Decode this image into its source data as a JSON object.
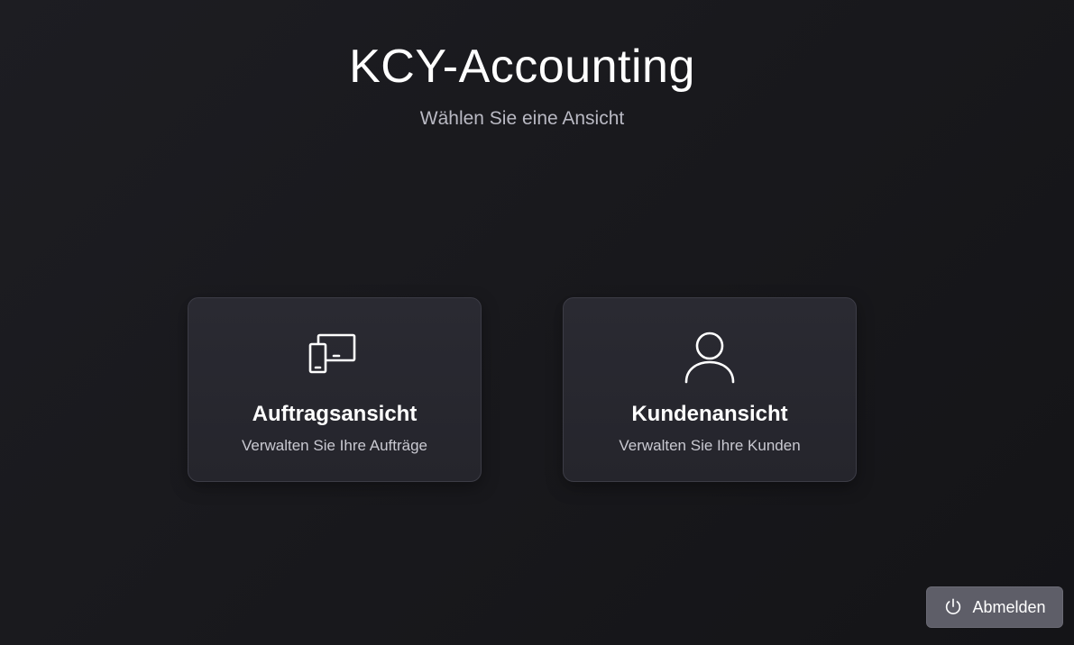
{
  "app": {
    "title": "KCY-Accounting",
    "subtitle": "Wählen Sie eine Ansicht"
  },
  "cards": [
    {
      "icon": "devices-icon",
      "title": "Auftragsansicht",
      "description": "Verwalten Sie Ihre Aufträge"
    },
    {
      "icon": "person-icon",
      "title": "Kundenansicht",
      "description": "Verwalten Sie Ihre Kunden"
    }
  ],
  "logout": {
    "icon": "power-icon",
    "label": "Abmelden"
  },
  "colors": {
    "background": "#18181c",
    "card_background": "#28282f",
    "card_border": "#3c3c46",
    "logout_button": "#5e5e68",
    "subtitle_text": "#b9b9c3"
  }
}
